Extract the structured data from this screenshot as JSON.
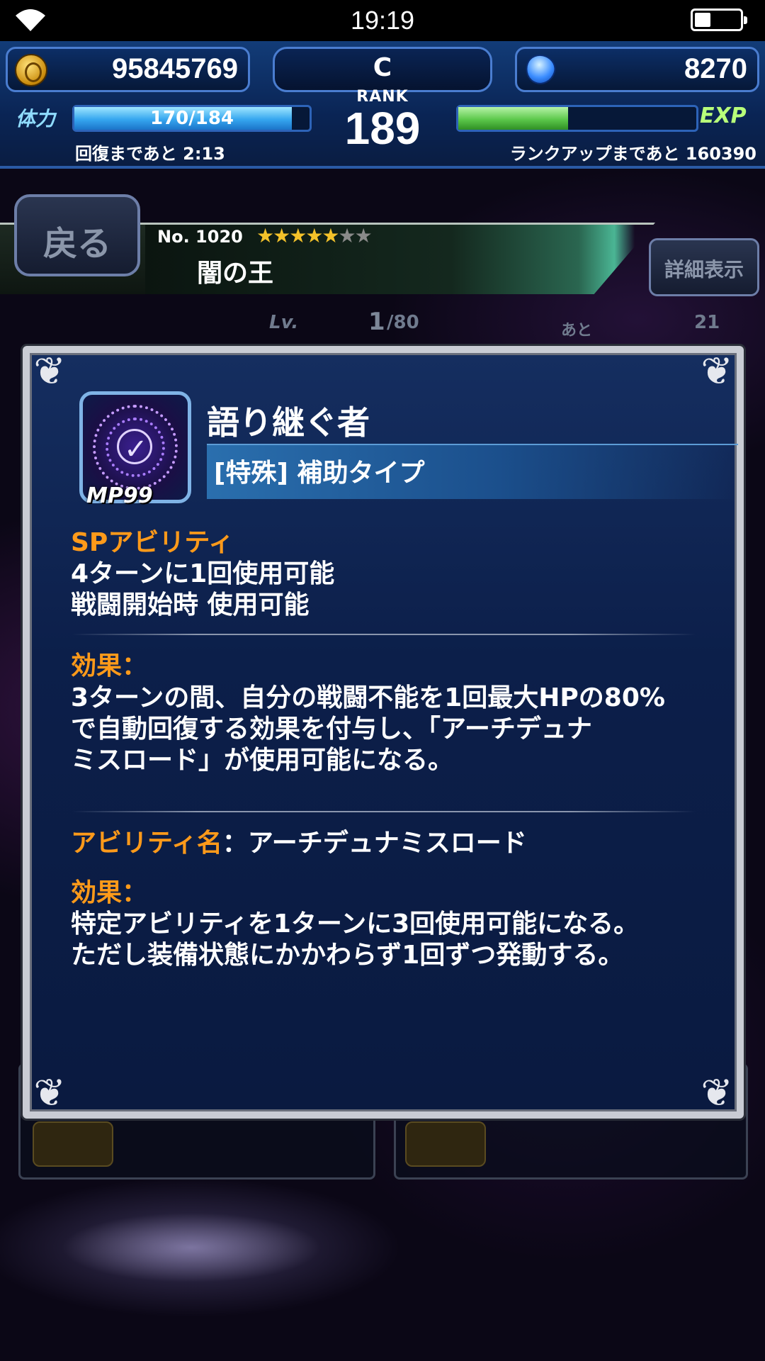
{
  "status_bar": {
    "time": "19:19"
  },
  "header": {
    "gil": "95845769",
    "gems": "8270",
    "rank_letter": "C",
    "rank_label": "RANK",
    "rank_value": "189",
    "stamina_label": "体力",
    "stamina_text": "170/184",
    "stamina_fraction": 0.924,
    "recovery_text": "回復まであと 2:13",
    "exp_label": "EXP",
    "exp_fraction": 0.46,
    "rankup_text": "ランクアップまであと 160390"
  },
  "unit": {
    "back_label": "戻る",
    "number": "No. 1020",
    "stars_filled": "★★★★★",
    "stars_empty": "★★",
    "name": "闇の王",
    "detail_label": "詳細表示",
    "lv_label": "Lv.",
    "lv_current": "1",
    "lv_max": "/80",
    "remaining_label": "あと",
    "remaining_value": "21"
  },
  "modal": {
    "ability_name": "語り継ぐ者",
    "ability_type": "[特殊] 補助タイプ",
    "mp": "MP99",
    "sp_title": "SPアビリティ",
    "sp_line1": "4ターンに1回使用可能",
    "sp_line2": "戦闘開始時 使用可能",
    "effect_label": "効果：",
    "effect_line1": "3ターンの間、自分の戦闘不能を1回最大HPの80%",
    "effect_line2": "で自動回復する効果を付与し、「アーチデュナ",
    "effect_line3": "ミスロード」が使用可能になる。",
    "sub_ability_label": "アビリティ名",
    "sub_ability_colon": "：",
    "sub_ability_name": "アーチデュナミスロード",
    "effect2_label": "効果：",
    "effect2_line1": "特定アビリティを1ターンに3回使用可能になる。",
    "effect2_line2": "ただし装備状態にかかわらず1回ずつ発動する。"
  },
  "colors": {
    "accent_orange": "#ff9a1a",
    "hp_blue": "#36a6ef",
    "exp_green": "#5cc84b"
  }
}
